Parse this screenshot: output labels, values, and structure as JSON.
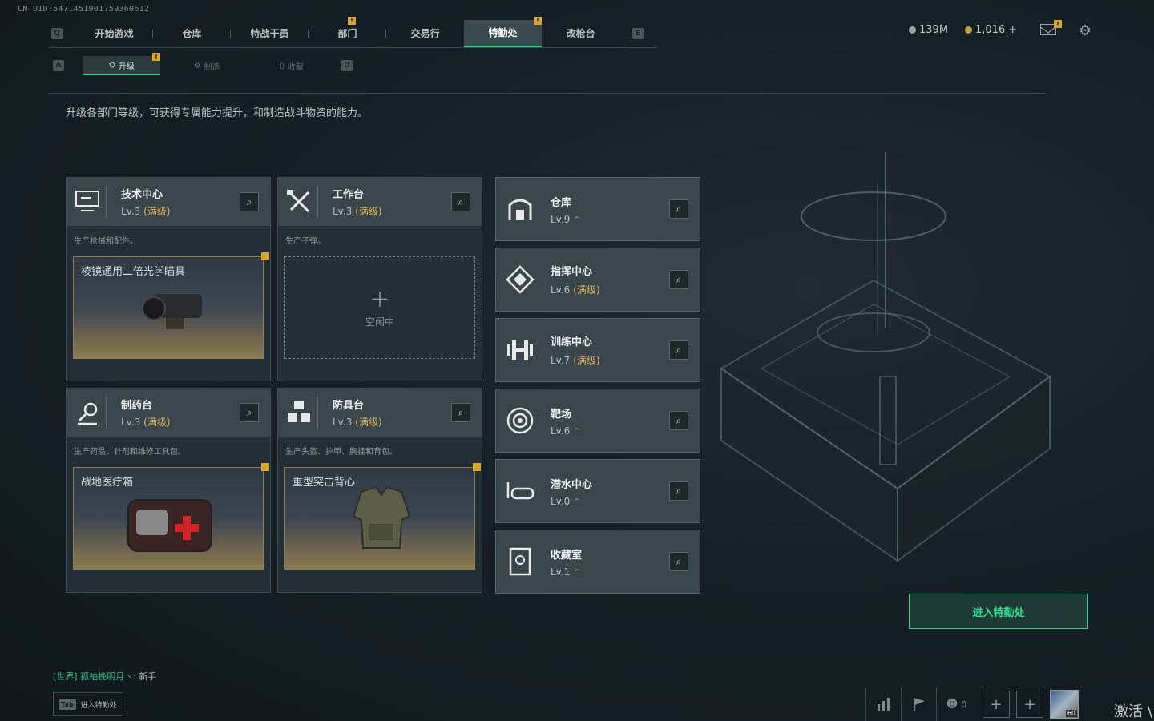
{
  "uid": "CN UID:5471451901759360612",
  "nav": {
    "left_key": "Q",
    "right_key": "E",
    "tabs": [
      {
        "label": "开始游戏",
        "active": false,
        "notif": false
      },
      {
        "label": "仓库",
        "active": false,
        "notif": false
      },
      {
        "label": "特战干员",
        "active": false,
        "notif": false
      },
      {
        "label": "部门",
        "active": false,
        "notif": true
      },
      {
        "label": "交易行",
        "active": false,
        "notif": false
      },
      {
        "label": "特勤处",
        "active": true,
        "notif": true
      },
      {
        "label": "改枪台",
        "active": false,
        "notif": false
      }
    ],
    "notif_mark": "!"
  },
  "subnav": {
    "left_key": "A",
    "right_key": "D",
    "tabs": [
      {
        "label": "升级",
        "active": true
      },
      {
        "label": "制造",
        "active": false
      },
      {
        "label": "收藏",
        "active": false
      }
    ]
  },
  "currency": {
    "silver": "139M",
    "gold": "1,016",
    "gold_add": "+"
  },
  "description": "升级各部门等级，可获得专属能力提升，和制造战斗物资的能力。",
  "cards": [
    {
      "title": "技术中心",
      "level": "Lv.3",
      "max_label": "(满级)",
      "sub": "生产枪械和配件。",
      "product": "棱镜通用二倍光学瞄具"
    },
    {
      "title": "工作台",
      "level": "Lv.3",
      "max_label": "(满级)",
      "sub": "生产子弹。",
      "empty_label": "空闲中"
    },
    {
      "title": "制药台",
      "level": "Lv.3",
      "max_label": "(满级)",
      "sub": "生产药品、针剂和维修工具包。",
      "product": "战地医疗箱"
    },
    {
      "title": "防具台",
      "level": "Lv.3",
      "max_label": "(满级)",
      "sub": "生产头盔、护甲、胸挂和背包。",
      "product": "重型突击背心"
    }
  ],
  "small_cards": [
    {
      "title": "仓库",
      "level": "Lv.9",
      "max_label": "",
      "upgrade": "⌃"
    },
    {
      "title": "指挥中心",
      "level": "Lv.6",
      "max_label": "(满级)",
      "upgrade": ""
    },
    {
      "title": "训练中心",
      "level": "Lv.7",
      "max_label": "(满级)",
      "upgrade": ""
    },
    {
      "title": "靶场",
      "level": "Lv.6",
      "max_label": "",
      "upgrade": "⌃"
    },
    {
      "title": "潜水中心",
      "level": "Lv.0",
      "max_label": "",
      "upgrade": "⌃"
    },
    {
      "title": "收藏室",
      "level": "Lv.1",
      "max_label": "",
      "upgrade": "⌃"
    }
  ],
  "enter_button": "进入特勤处",
  "chat": {
    "channel": "[世界]",
    "name": "孤袖挽明月丶",
    "message": ": 新手"
  },
  "tab_hint": {
    "key": "Tab",
    "label": "进入特勤处"
  },
  "bottombar": {
    "friends_count": "0",
    "avatar_level": "60"
  },
  "activate": "激活 \\"
}
